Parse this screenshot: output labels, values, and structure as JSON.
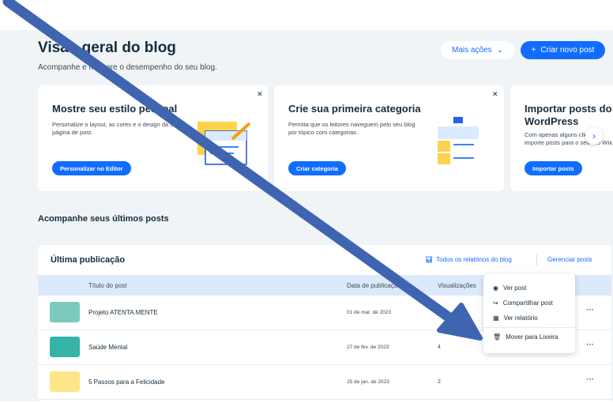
{
  "header": {
    "title": "Visão geral do blog",
    "subtitle": "Acompanhe e melhore o desempenho do seu blog.",
    "more_actions": "Mais ações",
    "new_post": "Criar novo post"
  },
  "cards": [
    {
      "title": "Mostre seu estilo pessoal",
      "desc": "Personalize o layout, as cores e o design da sua página de post.",
      "button": "Personalizar no Editor"
    },
    {
      "title": "Crie sua primeira categoria",
      "desc": "Permita que os leitores naveguem pelo seu blog por tópico com categorias.",
      "button": "Criar categoria"
    },
    {
      "title": "Importar posts do WordPress",
      "desc": "Com apenas alguns cliques, importe posts para o seu site Wix.",
      "button": "Importar posts"
    }
  ],
  "section_title": "Acompanhe seus últimos posts",
  "panel": {
    "title": "Última publicação",
    "reports_link": "Todos os relatórios do blog",
    "manage_link": "Gerenciar posts",
    "columns": [
      "Título do post",
      "Data de publicação",
      "Visualizações"
    ],
    "rows": [
      {
        "title": "Projeto ATENTA.MENTE",
        "date": "01 de mar. de 2023",
        "views": "2"
      },
      {
        "title": "Saúde Mental",
        "date": "27 de fev. de 2023",
        "views": "4"
      },
      {
        "title": "5 Passos para a Felicidade",
        "date": "25 de jan. de 2023",
        "views": "2"
      }
    ]
  },
  "menu": {
    "items": [
      "Ver post",
      "Compartilhar post",
      "Ver relatório"
    ],
    "trash": "Mover para Lixeira"
  },
  "icons": {
    "close": "close-icon",
    "chevron": "chevron-down-icon",
    "plus": "plus-icon",
    "eye": "eye-icon",
    "share": "share-icon",
    "chart": "chart-icon",
    "trash": "trash-icon",
    "next": "chevron-right-icon"
  },
  "colors": {
    "accent": "#116dff",
    "arrow": "#3f65b0"
  }
}
